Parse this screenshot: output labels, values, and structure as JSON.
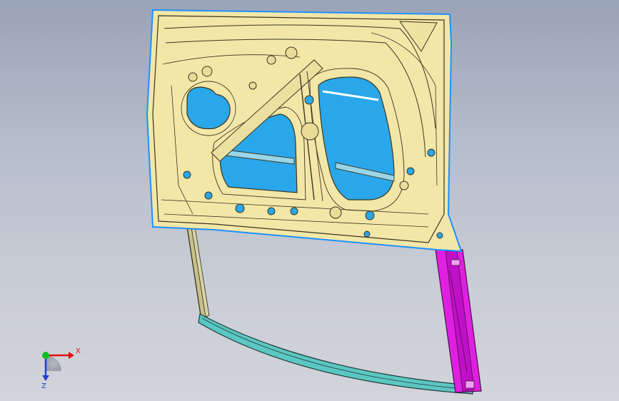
{
  "triad": {
    "x_label": "X",
    "z_label": "Z",
    "x_color": "#e01010",
    "y_color": "#10c020",
    "z_color": "#2040d0"
  },
  "colors": {
    "background_top": "#9aa3b7",
    "background_bottom": "#d2d4da",
    "panel_fill": "#f3e7a8",
    "panel_edge": "#3a3520",
    "opening_fill": "#2aa7ea",
    "frame_fill": "#5bc7c2",
    "pillar_fill": "#e020e0",
    "outline_blue": "#1e90ff"
  },
  "icons": {
    "model": "car-door-model",
    "triad": "axis-triad-icon"
  }
}
